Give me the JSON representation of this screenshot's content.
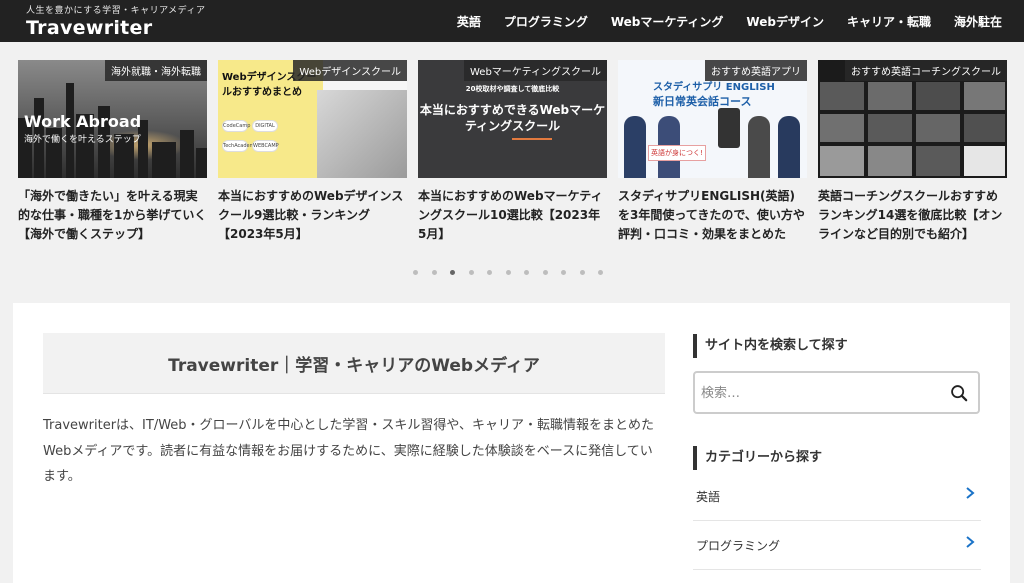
{
  "header": {
    "tagline": "人生を豊かにする学習・キャリアメディア",
    "logo": "Travewriter",
    "nav": [
      "英語",
      "プログラミング",
      "Webマーケティング",
      "Webデザイン",
      "キャリア・転職",
      "海外駐在"
    ]
  },
  "carousel": {
    "cards": [
      {
        "badge": "海外就職・海外転職",
        "title": "「海外で働きたい」を叶える現実的な仕事・職種を1から挙げていく【海外で働くステップ】",
        "thumb_text": "Work Abroad",
        "thumb_sub": "海外で働くを叶えるステップ"
      },
      {
        "badge": "Webデザインスクール",
        "title": "本当におすすめのWebデザインスクール9選比較・ランキング【2023年5月】",
        "thumb_text": "Webデザインスクールおすすめまとめ",
        "thumb_logos": [
          "CodeCamp",
          "DIGITAL",
          "TechAcademy",
          "WEBCAMP"
        ]
      },
      {
        "badge": "Webマーケティングスクール",
        "title": "本当におすすめのWebマーケティングスクール10選比較【2023年5月】",
        "thumb_small": "20校取材や調査して徹底比較",
        "thumb_text": "本当におすすめできるWebマーケティングスクール"
      },
      {
        "badge": "おすすめ英語アプリ",
        "title": "スタディサプリENGLISH(英語)を3年間使ってきたので、使い方や評判・口コミ・効果をまとめた",
        "thumb_text": "スタディサプリ ENGLISH",
        "thumb_sub": "新日常英会話コース",
        "thumb_bubble": "英語が身につく!"
      },
      {
        "badge": "おすすめ英語コーチングスクール",
        "title": "英語コーチングスクールおすすめランキング14選を徹底比較【オンラインなど目的別でも紹介】"
      }
    ],
    "dots": {
      "count": 11,
      "active": 2
    }
  },
  "main": {
    "site_title": "Travewriter｜学習・キャリアのWebメディア",
    "intro": "Travewriterは、IT/Web・グローバルを中心とした学習・スキル習得や、キャリア・転職情報をまとめたWebメディアです。読者に有益な情報をお届けするために、実際に経験した体験談をベースに発信しています。"
  },
  "sidebar": {
    "search_heading": "サイト内を検索して探す",
    "search_placeholder": "検索…",
    "category_heading": "カテゴリーから探す",
    "categories": [
      "英語",
      "プログラミング"
    ]
  },
  "colors": {
    "header_bg": "#222222",
    "chevron": "#1a73c8"
  }
}
